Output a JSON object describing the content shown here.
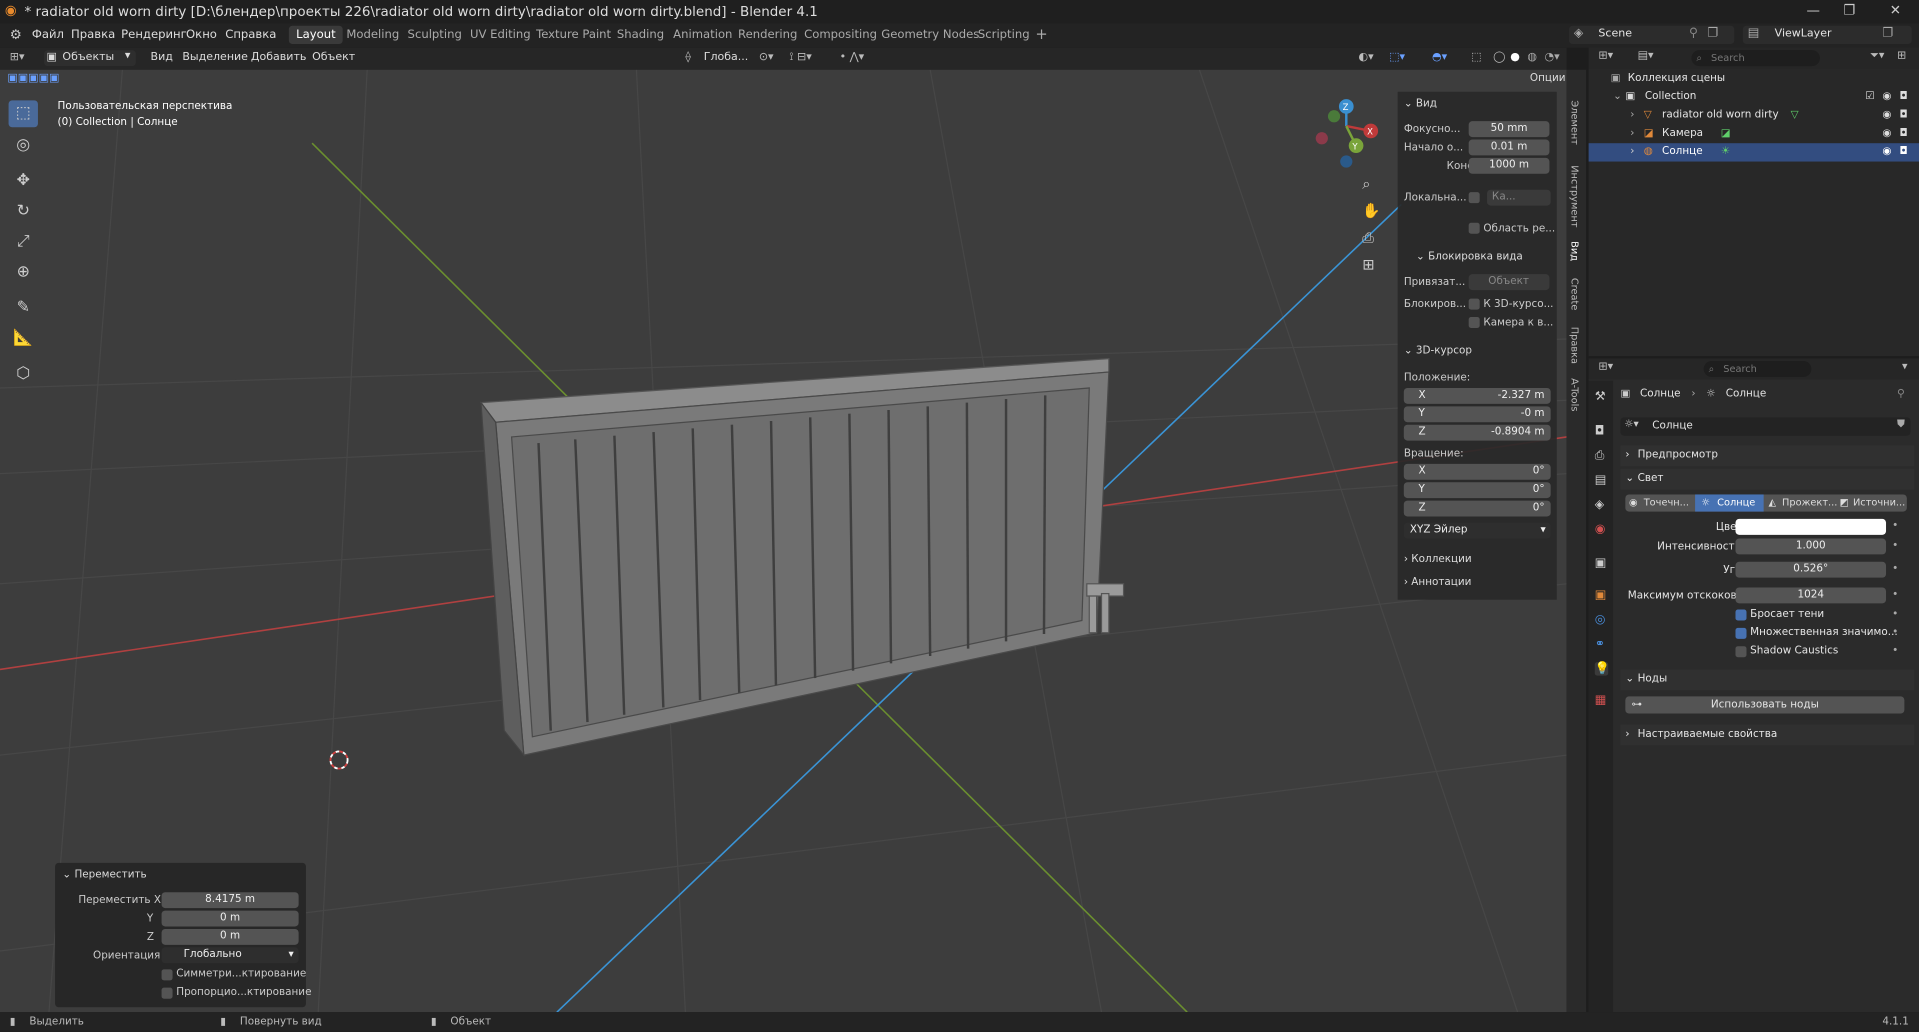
{
  "window": {
    "title": "* radiator old worn dirty [D:\\блендер\\проекты 226\\radiator old worn dirty\\radiator old worn dirty.blend] - Blender 4.1"
  },
  "menu": [
    "Файл",
    "Правка",
    "Рендеринг",
    "Окно",
    "Справка"
  ],
  "workspaces": [
    "Layout",
    "Modeling",
    "Sculpting",
    "UV Editing",
    "Texture Paint",
    "Shading",
    "Animation",
    "Rendering",
    "Compositing",
    "Geometry Nodes",
    "Scripting"
  ],
  "active_workspace": "Layout",
  "scene": {
    "name": "Scene",
    "view_layer": "ViewLayer"
  },
  "viewport_header": {
    "mode": "Объекты",
    "items": [
      "Вид",
      "Выделение",
      "Добавить",
      "Объект"
    ],
    "transform": "Глоба...",
    "options": "Опции"
  },
  "viewport": {
    "perspective": "Пользовательская перспектива",
    "collection_info": "(0) Collection | Солнце"
  },
  "npanel": {
    "view_header": "Вид",
    "focal_label": "Фокусно...",
    "focal_value": "50 mm",
    "clip_start_label": "Начало о...",
    "clip_start_value": "0.01 m",
    "clip_end_label": "Конец",
    "clip_end_value": "1000 m",
    "local_label": "Локальна...",
    "local_cam": "Ка...",
    "region_label": "Область ре...",
    "lock_header": "Блокировка вида",
    "bind_label": "Привязат...",
    "bind_placeholder": "Объект",
    "lock_label": "Блокиров...",
    "lock_cursor": "К 3D-курсо...",
    "lock_camera": "Камера к в...",
    "cursor_header": "3D-курсор",
    "position_label": "Положение:",
    "pos_x": "-2.327 m",
    "pos_y": "-0 m",
    "pos_z": "-0.8904 m",
    "rotation_label": "Вращение:",
    "rot_x": "0°",
    "rot_y": "0°",
    "rot_z": "0°",
    "rot_mode": "XYZ Эйлер",
    "collections": "Коллекции",
    "annotations": "Аннотации",
    "axis_x": "X",
    "axis_y": "Y",
    "axis_z": "Z"
  },
  "vertical_tabs": [
    "Элемент",
    "Инструмент",
    "Вид",
    "Create",
    "Правка",
    "A-Tools"
  ],
  "outliner": {
    "search": "Search",
    "root": "Коллекция сцены",
    "items": [
      "Collection",
      "radiator old worn dirty",
      "Камера",
      "Солнце"
    ]
  },
  "properties": {
    "search": "Search",
    "breadcrumb_a": "Солнце",
    "breadcrumb_b": "Солнце",
    "datablock": "Солнце",
    "preview": "Предпросмотр",
    "light_header": "Свет",
    "light_types": [
      "Точечн...",
      "Солнце",
      "Прожект...",
      "Источни..."
    ],
    "color_label": "Цвет",
    "color_value": "#ffffff",
    "strength_label": "Интенсивность",
    "strength_value": "1.000",
    "angle_label": "Угол",
    "angle_value": "0.526°",
    "bounces_label": "Максимум отскоков",
    "bounces_value": "1024",
    "cast_shadow": "Бросает тени",
    "multiple_importance": "Множественная значимо...",
    "shadow_caustics": "Shadow Caustics",
    "nodes_header": "Ноды",
    "use_nodes": "Использовать ноды",
    "custom_props": "Настраиваемые свойства"
  },
  "redo_panel": {
    "header": "Переместить",
    "move_x_label": "Переместить X",
    "move_x": "8.4175 m",
    "y_label": "Y",
    "move_y": "0 m",
    "z_label": "Z",
    "move_z": "0 m",
    "orientation_label": "Ориентация",
    "orientation": "Глобально",
    "symmetry": "Симметри...ктирование",
    "proportional": "Пропорцио...ктирование"
  },
  "statusbar": {
    "select": "Выделить",
    "rotate": "Повернуть вид",
    "object": "Объект",
    "version": "4.1.1"
  },
  "colors": {
    "accent": "#4772b3",
    "viewport_bg": "#3d3d3d",
    "x_axis": "#c03a3a",
    "y_axis": "#7aa43a",
    "z_axis": "#3a8fd0"
  }
}
